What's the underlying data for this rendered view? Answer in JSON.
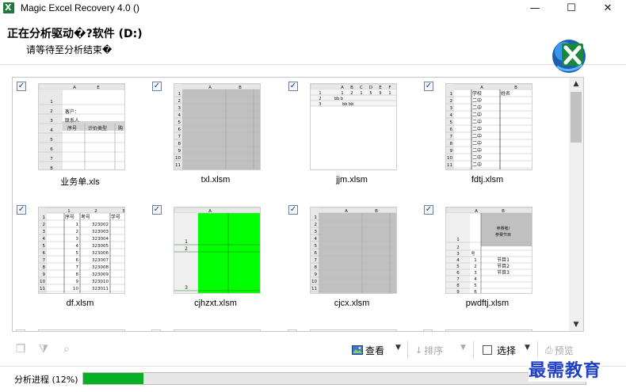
{
  "window": {
    "title": "Magic Excel Recovery 4.0 ()",
    "controls": {
      "minimize": "—",
      "maximize": "☐",
      "close": "✕"
    }
  },
  "header": {
    "heading": "正在分析驱动�?软件 (D:)",
    "subheading": "请等待至分析结束�",
    "logo_icon": "excel-recovery-logo-icon"
  },
  "files": [
    {
      "name": "业务单.xls",
      "checked": true,
      "thumb": "form"
    },
    {
      "name": "txl.xlsm",
      "checked": true,
      "thumb": "gray"
    },
    {
      "name": "jjm.xlsm",
      "checked": true,
      "thumb": "small"
    },
    {
      "name": "fdtj.xlsm",
      "checked": true,
      "thumb": "list"
    },
    {
      "name": "df.xlsm",
      "checked": true,
      "thumb": "numbers"
    },
    {
      "name": "cjhzxt.xlsm",
      "checked": true,
      "thumb": "green"
    },
    {
      "name": "cjcx.xlsm",
      "checked": true,
      "thumb": "gray"
    },
    {
      "name": "pwdftj.xlsm",
      "checked": true,
      "thumb": "program"
    }
  ],
  "thumbs": {
    "form": {
      "headers": [
        "A",
        "E"
      ],
      "rows": [
        "1",
        "2",
        "3",
        "4",
        "5",
        "6",
        "7",
        "8"
      ],
      "cells": [
        "客户：",
        "联系人",
        "序号",
        "计价类型",
        "购"
      ]
    },
    "gray": {
      "headers": [
        "A",
        "B"
      ],
      "rows": [
        "1",
        "2",
        "3",
        "4",
        "5",
        "6",
        "7",
        "8",
        "9",
        "10",
        "11"
      ]
    },
    "small": {
      "headers": [
        "A",
        "B",
        "C",
        "D",
        "E",
        "F"
      ],
      "rows": [
        "1",
        "2",
        "3"
      ],
      "row1": [
        "1",
        "2",
        "1",
        "5",
        "9",
        "1"
      ],
      "row2": "bb b",
      "row3": "bb bb"
    },
    "list": {
      "headers": [
        "A",
        "B"
      ],
      "rows": [
        "1",
        "2",
        "3",
        "4",
        "5",
        "6",
        "7",
        "8",
        "9",
        "10",
        "11"
      ],
      "colA": "学校",
      "colB": "姓名",
      "value": "二中"
    },
    "numbers": {
      "headers": [
        "1",
        "2",
        "3"
      ],
      "head": [
        "序号",
        "考号",
        "学号"
      ],
      "rows": [
        "1",
        "2",
        "3",
        "4",
        "5",
        "6",
        "7",
        "8",
        "9",
        "10",
        "11"
      ],
      "ids": [
        "1",
        "2",
        "3",
        "4",
        "5",
        "6",
        "7",
        "8",
        "9",
        "10"
      ],
      "codes": [
        "323002",
        "323003",
        "323004",
        "323005",
        "323006",
        "323007",
        "323008",
        "323009",
        "323010",
        "323011"
      ]
    },
    "green": {
      "headers": [
        "A"
      ],
      "rows": [
        "1",
        "2",
        "3"
      ]
    },
    "program": {
      "headers": [
        "A",
        "B"
      ],
      "rows": [
        "1",
        "2",
        "3",
        "4",
        "5",
        "6",
        "7",
        "8",
        "9"
      ],
      "title": "参赛者/参赛节目",
      "items": [
        "节目1",
        "节目2",
        "节目3"
      ],
      "nums": [
        "1",
        "2",
        "3",
        "4",
        "5",
        "6"
      ],
      "mark": "号"
    }
  },
  "toolbar": {
    "view_label": "查看",
    "sort_label": "排序",
    "select_label": "选择",
    "preview_label": "预览"
  },
  "progress": {
    "label": "分析进程 (12%)",
    "percent": 12
  },
  "watermark": "最需教育",
  "colors": {
    "progress": "#06b025",
    "green_sheet": "#00ff00",
    "gray_sheet": "#c0c0c0"
  }
}
